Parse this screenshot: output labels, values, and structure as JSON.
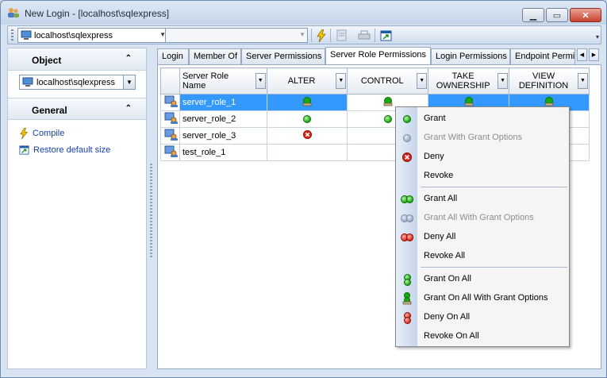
{
  "window": {
    "title": "New Login - [localhost\\sqlexpress]"
  },
  "toolbar": {
    "server": "localhost\\sqlexpress",
    "database": ""
  },
  "left_panel": {
    "object_header": "Object",
    "object_value": "localhost\\sqlexpress",
    "general_header": "General",
    "links": [
      "Compile",
      "Restore default size"
    ]
  },
  "tabs": [
    "Login",
    "Member Of",
    "Server Permissions",
    "Server Role Permissions",
    "Login Permissions",
    "Endpoint Permis"
  ],
  "grid": {
    "columns": [
      "Server Role Name",
      "ALTER",
      "CONTROL",
      "TAKE OWNERSHIP",
      "VIEW DEFINITION"
    ],
    "rows": [
      {
        "name": "server_role_1",
        "alter": "grant-with-option",
        "control": "grant-with-option",
        "take": "grant-with-option",
        "view": "grant-with-option"
      },
      {
        "name": "server_role_2",
        "alter": "grant",
        "control": "grant",
        "take": "",
        "view": ""
      },
      {
        "name": "server_role_3",
        "alter": "deny",
        "control": "",
        "take": "",
        "view": ""
      },
      {
        "name": "test_role_1",
        "alter": "",
        "control": "",
        "take": "",
        "view": ""
      }
    ]
  },
  "context_menu": {
    "items": [
      {
        "label": "Grant",
        "icon": "grant-icon",
        "enabled": true
      },
      {
        "label": "Grant With Grant Options",
        "icon": "grant-with-options-icon",
        "enabled": false
      },
      {
        "label": "Deny",
        "icon": "deny-icon",
        "enabled": true
      },
      {
        "label": "Revoke",
        "icon": "",
        "enabled": true
      },
      {
        "label": "Grant All",
        "icon": "grant-all-icon",
        "enabled": true
      },
      {
        "label": "Grant All With Grant Options",
        "icon": "grant-all-with-options-icon",
        "enabled": false
      },
      {
        "label": "Deny All",
        "icon": "deny-all-icon",
        "enabled": true
      },
      {
        "label": "Revoke All",
        "icon": "",
        "enabled": true
      },
      {
        "label": "Grant On All",
        "icon": "grant-on-all-icon",
        "enabled": true
      },
      {
        "label": "Grant On All With Grant Options",
        "icon": "grant-on-all-with-options-icon",
        "enabled": true
      },
      {
        "label": "Deny On All",
        "icon": "deny-on-all-icon",
        "enabled": true
      },
      {
        "label": "Revoke On All",
        "icon": "",
        "enabled": true
      }
    ]
  },
  "colors": {
    "grant": "#18a80f",
    "deny": "#d7281a",
    "selection": "#3399ff"
  }
}
